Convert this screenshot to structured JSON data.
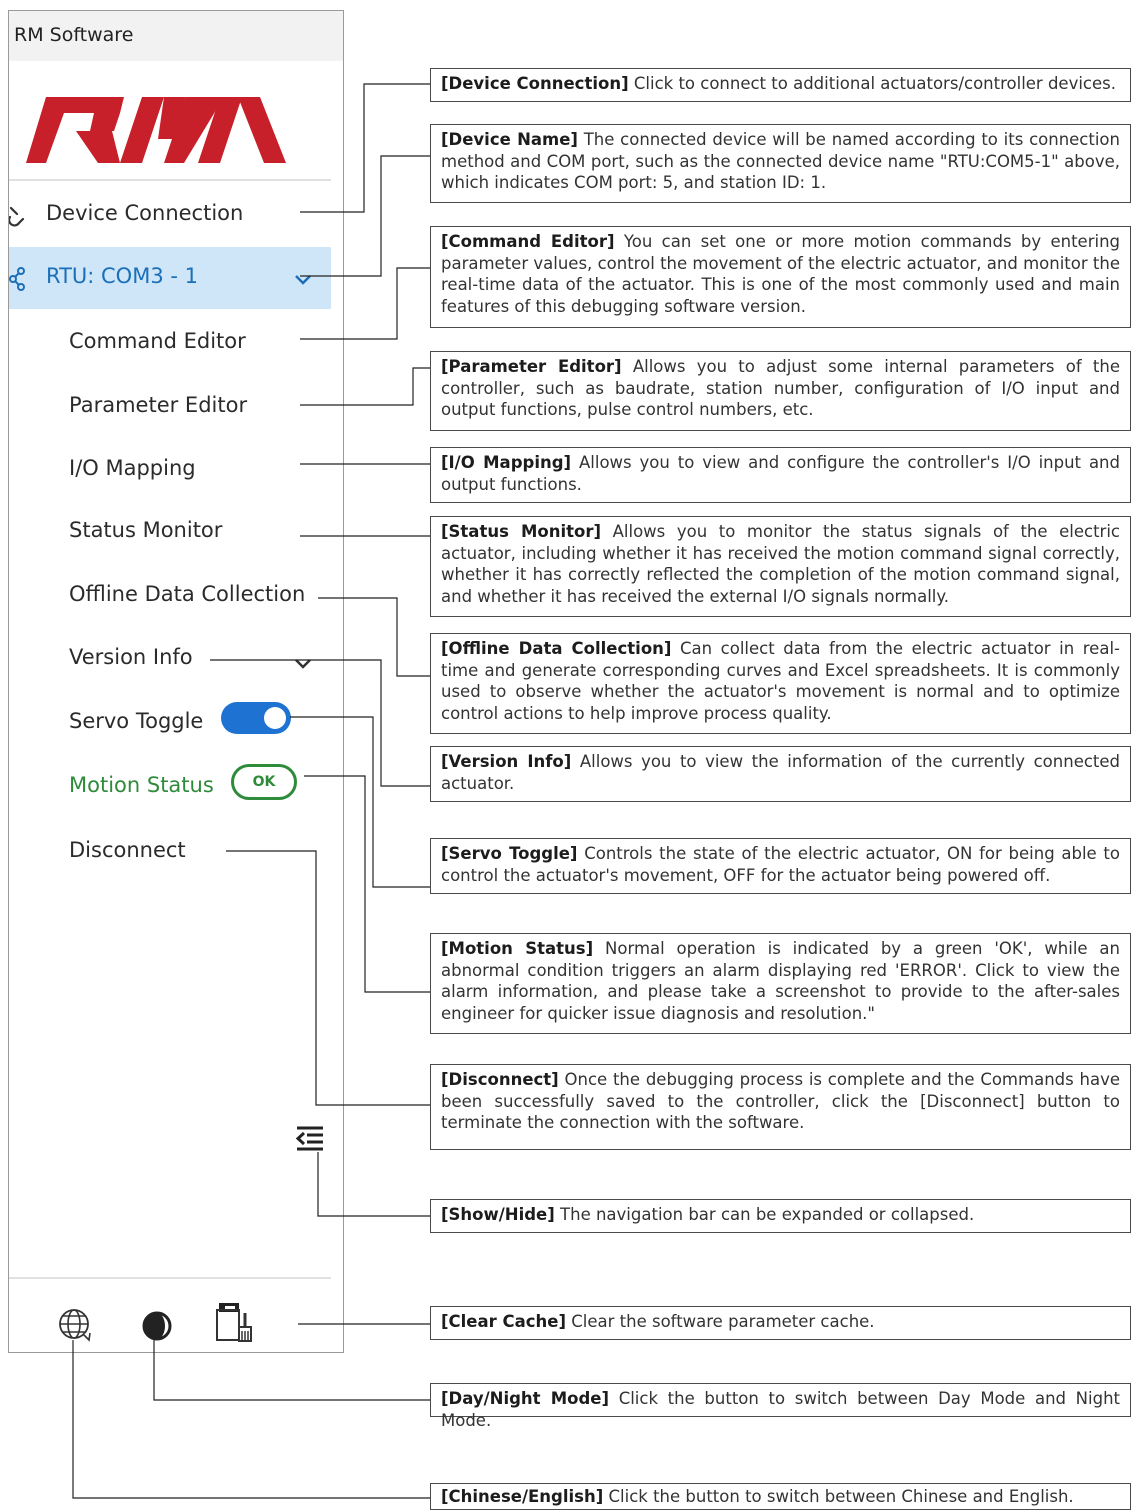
{
  "app": {
    "title": "RM Software",
    "logo_text": "RM"
  },
  "nav": {
    "device_connection": "Device Connection",
    "device_name": "RTU: COM3 - 1",
    "items": {
      "command_editor": "Command Editor",
      "parameter_editor": "Parameter Editor",
      "io_mapping": "I/O Mapping",
      "status_monitor": "Status Monitor",
      "offline_data": "Offline Data Collection",
      "version_info": "Version Info",
      "servo_toggle": "Servo Toggle",
      "motion_status": "Motion Status",
      "disconnect": "Disconnect"
    },
    "servo_on": true,
    "motion_status_value": "OK"
  },
  "icons": {
    "device_connection": "link-icon",
    "device_name": "share-node-icon",
    "collapse": "collapse-menu-icon",
    "language": "globe-icon",
    "theme": "day-night-icon",
    "clear_cache": "clear-cache-icon"
  },
  "colors": {
    "selected_bg": "#cfe6f8",
    "selected_text": "#1b6fb8",
    "logo_red": "#c8202a",
    "toggle_blue": "#1e73d2",
    "ok_green": "#2e8b3a"
  },
  "callouts": {
    "device_connection": {
      "tag": "[Device Connection]",
      "text": " Click to connect to additional actuators/controller devices."
    },
    "device_name": {
      "tag": "[Device Name]",
      "text": " The connected device will be named according to its connection method and COM port, such as the connected device name \"RTU:COM5-1\" above, which indicates COM port: 5, and station ID: 1."
    },
    "command_editor": {
      "tag": "[Command Editor]",
      "text": " You can set one or more motion commands by entering parameter values, control the movement of the electric actuator, and monitor the real-time data of the actuator. This is one of the most commonly used and main features of this debugging software version."
    },
    "parameter_editor": {
      "tag": "[Parameter Editor]",
      "text": " Allows you to adjust some internal parameters of the controller, such as baudrate, station number, configuration of I/O input and output functions, pulse control numbers, etc."
    },
    "io_mapping": {
      "tag": "[I/O Mapping]",
      "text": " Allows you to view and configure the controller's I/O input and output functions."
    },
    "status_monitor": {
      "tag": "[Status Monitor]",
      "text": " Allows you to monitor the status signals of the electric actuator, including whether it has received the motion command signal correctly, whether it has correctly reflected the completion of the motion command signal, and whether it has received the external I/O signals normally."
    },
    "offline_data": {
      "tag": "[Offline Data Collection]",
      "text": " Can collect data from the electric actuator in real-time and generate corresponding curves and Excel spreadsheets. It is commonly used to observe whether the actuator's movement is normal and to optimize control actions to help improve process quality."
    },
    "version_info": {
      "tag": "[Version Info]",
      "text": " Allows you to view the information of the currently connected actuator."
    },
    "servo_toggle": {
      "tag": "[Servo Toggle]",
      "text": " Controls the state of the electric actuator, ON for being able to control the actuator's movement, OFF for the actuator being powered off."
    },
    "motion_status": {
      "tag": "[Motion Status]",
      "text": " Normal operation is indicated by a green 'OK', while an abnormal condition triggers an alarm displaying red 'ERROR'. Click to view the alarm information, and please take a screenshot to provide to the after-sales engineer for quicker issue diagnosis and resolution.\""
    },
    "disconnect": {
      "tag": "[Disconnect]",
      "text": " Once the debugging process is complete and the Commands have been successfully saved to the controller, click the [Disconnect] button to terminate the connection with the software."
    },
    "show_hide": {
      "tag": "[Show/Hide]",
      "text": " The navigation bar can be expanded or collapsed."
    },
    "clear_cache": {
      "tag": "[Clear Cache]",
      "text": " Clear the software parameter cache."
    },
    "day_night": {
      "tag": "[Day/Night Mode]",
      "text": " Click the button to switch between Day Mode and Night Mode."
    },
    "language": {
      "tag": "[Chinese/English]",
      "text": " Click the button to switch between Chinese and English."
    }
  }
}
